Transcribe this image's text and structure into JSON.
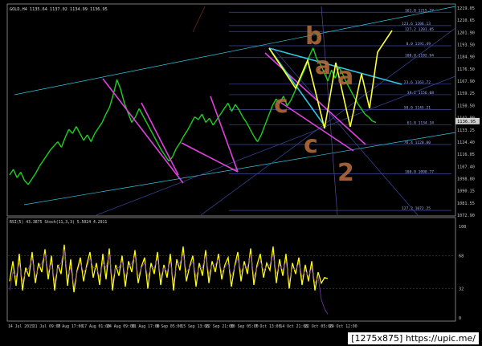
{
  "header": {
    "main_panel_title": "GOLD,H4  1135.64 1137.02 1134.99 1136.95",
    "sub_panel_title": "RSI(5) 43.3875  Stoch(11,3,3) 5.5024 4.2911"
  },
  "watermark": "[1275x875] https://upic.me/",
  "colors": {
    "background": "#000000",
    "candles": "#1fd11f",
    "rsi": "#ffff00",
    "stoch": "#7a3bb0",
    "magenta_arrows": "#e040e0",
    "cyan_lines": "#30c8e0",
    "yellow_path": "#ffff33",
    "annotation_brown": "#b06a3a",
    "fib_lines": "#3a4aa0",
    "price_tag": "#d0d0d0"
  },
  "chart_data": [
    {
      "type": "line",
      "panel": "price",
      "title": "GOLD,H4",
      "ylim": [
        1070,
        1220
      ],
      "y_ticks": [
        "1219.05",
        "1210.65",
        "1201.90",
        "1193.50",
        "1184.90",
        "1176.50",
        "1167.90",
        "1159.25",
        "1150.50",
        "1141.90",
        "1133.25",
        "1124.40",
        "1116.05",
        "1107.40",
        "1098.80",
        "1090.15",
        "1081.55",
        "1072.90"
      ],
      "x_ticks": [
        "14 Jul 2015",
        "31 Jul 09:00",
        "7 Aug 17:00",
        "17 Aug 01:00",
        "24 Aug 09:00",
        "31 Aug 17:00",
        "9 Sep 05:00",
        "15 Sep 13:00",
        "22 Sep 21:00",
        "30 Sep 05:00",
        "7 Oct 13:00",
        "14 Oct 21:00",
        "22 Oct 05:00",
        "29 Oct 12:00"
      ],
      "current_price": "1136.95",
      "series": [
        {
          "values": [
            1098,
            1102,
            1096,
            1100,
            1094,
            1091,
            1095,
            1099,
            1104,
            1108,
            1112,
            1116,
            1119,
            1122,
            1118,
            1125,
            1131,
            1128,
            1133,
            1128,
            1123,
            1127,
            1122,
            1128,
            1132,
            1136,
            1142,
            1147,
            1156,
            1167,
            1160,
            1150,
            1143,
            1136,
            1140,
            1146,
            1141,
            1136,
            1131,
            1126,
            1121,
            1116,
            1112,
            1108,
            1111,
            1117,
            1121,
            1126,
            1130,
            1135,
            1140,
            1138,
            1142,
            1136,
            1139,
            1134,
            1138,
            1142,
            1146,
            1150,
            1144,
            1149,
            1145,
            1140,
            1136,
            1131,
            1126,
            1122,
            1127,
            1134,
            1141,
            1148,
            1153,
            1150,
            1155,
            1148,
            1152,
            1158,
            1164,
            1170,
            1176,
            1184,
            1190,
            1182,
            1178,
            1172,
            1166,
            1174,
            1168,
            1176,
            1171,
            1165,
            1160,
            1155,
            1150,
            1146,
            1142,
            1140,
            1137,
            1136
          ]
        }
      ],
      "fib_levels": [
        {
          "label": "161.8",
          "price": "1215.77"
        },
        {
          "label": "123.6",
          "price": "1206.13"
        },
        {
          "label": "127.2",
          "price": "1201.85"
        },
        {
          "label": "0.0",
          "price": "1191.49"
        },
        {
          "label": "100.0",
          "price": "1182.94"
        },
        {
          "label": "23.6",
          "price": "1163.72"
        },
        {
          "label": "38.2",
          "price": "1156.08"
        },
        {
          "label": "50.0",
          "price": "1145.21"
        },
        {
          "label": "61.8",
          "price": "1134.34"
        },
        {
          "label": "76.4",
          "price": "1120.00"
        },
        {
          "label": "100.0",
          "price": "1098.77"
        },
        {
          "label": "127.2",
          "price": "1072.25"
        }
      ],
      "annotations": [
        "b",
        "a",
        "a",
        "c",
        "c",
        "2"
      ]
    },
    {
      "type": "line",
      "panel": "oscillator",
      "title": "RSI(5) 43.3875  Stoch(11,3,3) 5.5024 4.2911",
      "ylim": [
        0,
        100
      ],
      "y_ticks": [
        "100",
        "68",
        "32",
        "0"
      ],
      "series": [
        {
          "name": "RSI(5)",
          "values": [
            40,
            62,
            35,
            70,
            30,
            55,
            45,
            72,
            38,
            60,
            50,
            75,
            42,
            68,
            30,
            58,
            48,
            80,
            35,
            64,
            28,
            52,
            66,
            40,
            58,
            72,
            44,
            60,
            36,
            70,
            42,
            76,
            30,
            58,
            46,
            68,
            34,
            62,
            50,
            74,
            38,
            56,
            66,
            32,
            60,
            48,
            72,
            36,
            58,
            44,
            70,
            30,
            64,
            52,
            78,
            40,
            56,
            68,
            34,
            60,
            46,
            74,
            38,
            62,
            50,
            70,
            42,
            58,
            66,
            34,
            56,
            72,
            40,
            62,
            48,
            76,
            36,
            58,
            70,
            44,
            60,
            52,
            78,
            38,
            64,
            46,
            70,
            32,
            60,
            48,
            66,
            36,
            58,
            40,
            62,
            30,
            50,
            38,
            44,
            43
          ]
        },
        {
          "name": "Stoch(11,3,3)",
          "values": [
            30,
            50,
            45,
            60,
            40,
            50,
            55,
            65,
            45,
            55,
            60,
            70,
            50,
            60,
            40,
            55,
            60,
            75,
            45,
            55,
            35,
            50,
            60,
            50,
            55,
            65,
            55,
            55,
            45,
            60,
            55,
            70,
            40,
            55,
            55,
            62,
            45,
            55,
            60,
            68,
            45,
            55,
            60,
            45,
            55,
            55,
            65,
            45,
            55,
            50,
            62,
            40,
            58,
            60,
            70,
            50,
            55,
            62,
            45,
            55,
            55,
            68,
            48,
            58,
            58,
            65,
            50,
            55,
            60,
            45,
            55,
            65,
            50,
            58,
            55,
            70,
            45,
            55,
            62,
            52,
            56,
            58,
            70,
            48,
            58,
            52,
            62,
            40,
            55,
            52,
            60,
            45,
            52,
            45,
            55,
            38,
            45,
            20,
            10,
            4
          ]
        }
      ]
    }
  ]
}
